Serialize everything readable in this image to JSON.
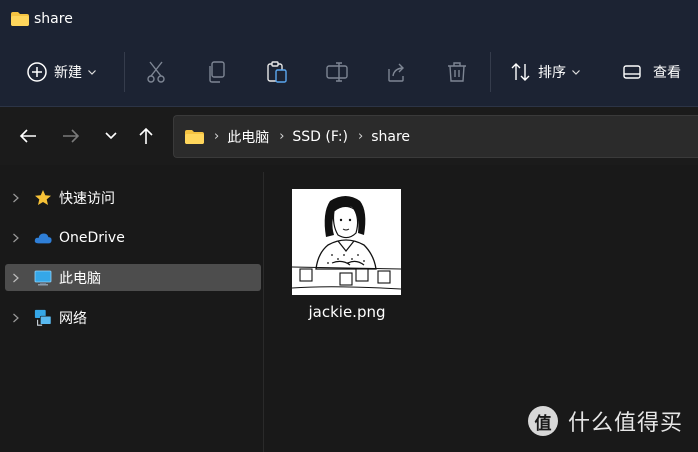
{
  "window": {
    "title": "share"
  },
  "toolbar": {
    "new_label": "新建",
    "sort_label": "排序",
    "view_label": "查看",
    "icons": [
      "plus-circle-icon",
      "cut-icon",
      "copy-icon",
      "paste-icon",
      "rename-icon",
      "share-icon",
      "delete-icon",
      "sort-icon",
      "view-icon"
    ]
  },
  "address": {
    "crumbs": [
      "此电脑",
      "SSD (F:)",
      "share"
    ]
  },
  "sidebar": {
    "items": [
      {
        "label": "快速访问",
        "icon": "star-icon"
      },
      {
        "label": "OneDrive",
        "icon": "cloud-icon"
      },
      {
        "label": "此电脑",
        "icon": "monitor-icon",
        "selected": true
      },
      {
        "label": "网络",
        "icon": "network-icon"
      }
    ]
  },
  "content": {
    "files": [
      {
        "name": "jackie.png"
      }
    ]
  },
  "watermark": {
    "badge": "值",
    "text": "什么值得买"
  }
}
